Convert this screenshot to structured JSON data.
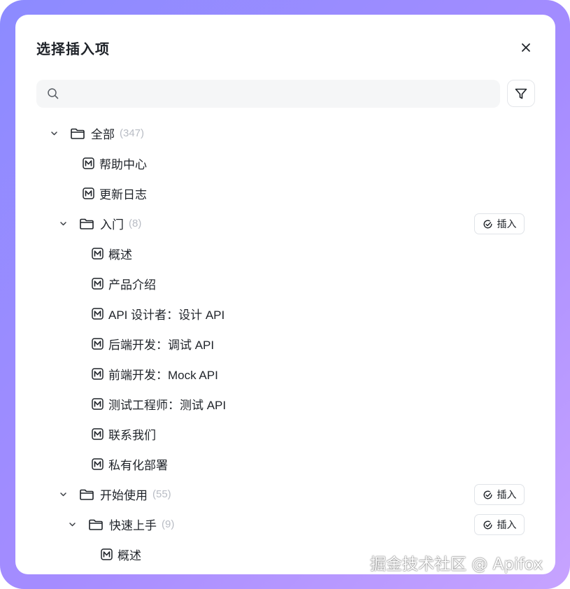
{
  "dialog": {
    "title": "选择插入项",
    "search_placeholder": "",
    "icons": {
      "close": "close-icon",
      "search": "search-icon",
      "filter": "filter-icon"
    }
  },
  "tree": {
    "insert_label": "插入",
    "items": [
      {
        "type": "folder",
        "label": "全部",
        "count": "(347)",
        "depth": 0,
        "expanded": true,
        "insert": false
      },
      {
        "type": "doc",
        "label": "帮助中心",
        "depth": 1
      },
      {
        "type": "doc",
        "label": "更新日志",
        "depth": 1
      },
      {
        "type": "folder",
        "label": "入门",
        "count": "(8)",
        "depth": 1,
        "expanded": true,
        "insert": true
      },
      {
        "type": "doc",
        "label": "概述",
        "depth": 2
      },
      {
        "type": "doc",
        "label": "产品介绍",
        "depth": 2
      },
      {
        "type": "doc",
        "label": "API 设计者：设计 API",
        "depth": 2
      },
      {
        "type": "doc",
        "label": "后端开发：调试 API",
        "depth": 2
      },
      {
        "type": "doc",
        "label": "前端开发：Mock API",
        "depth": 2
      },
      {
        "type": "doc",
        "label": "测试工程师：测试 API",
        "depth": 2
      },
      {
        "type": "doc",
        "label": "联系我们",
        "depth": 2
      },
      {
        "type": "doc",
        "label": "私有化部署",
        "depth": 2
      },
      {
        "type": "folder",
        "label": "开始使用",
        "count": "(55)",
        "depth": 1,
        "expanded": true,
        "insert": true
      },
      {
        "type": "folder",
        "label": "快速上手",
        "count": "(9)",
        "depth": 2,
        "expanded": true,
        "insert": true
      },
      {
        "type": "doc",
        "label": "概述",
        "depth": 3
      }
    ]
  },
  "watermark": "掘金技术社区 @ Apifox",
  "colors": {
    "frame_start": "#8c8bff",
    "frame_end": "#c7a3ff",
    "text": "#1f2329",
    "muted": "#b8bcc4"
  }
}
